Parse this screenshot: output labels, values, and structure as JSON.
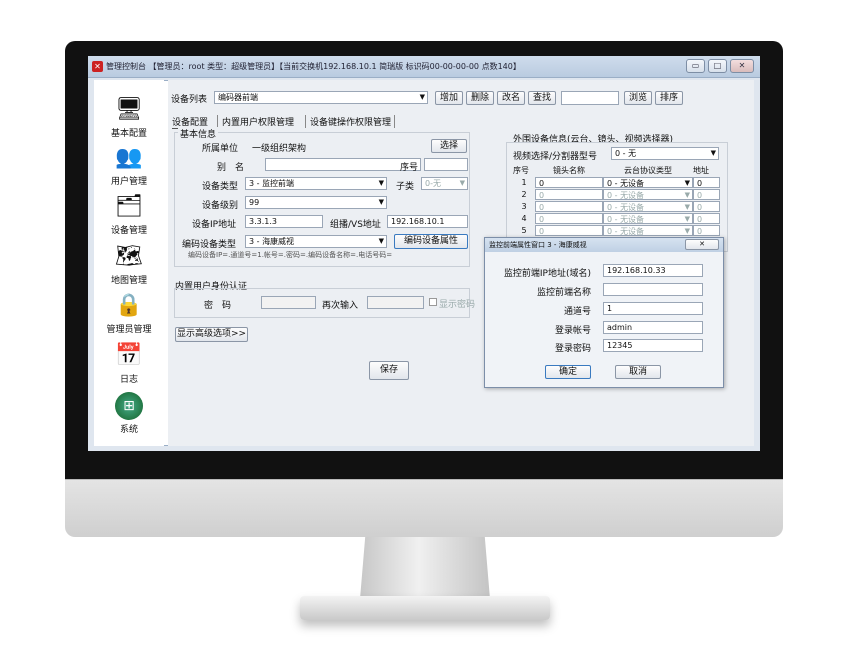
{
  "window": {
    "title": "管理控制台 【管理员：root 类型：超级管理员】【当前交换机192.168.10.1 简瑞版 标识码00-00-00-00 点数140】",
    "buttons": {
      "minimize": "▭",
      "maximize": "□",
      "close": "✕"
    }
  },
  "sidebar": {
    "items": [
      {
        "label": "基本配置",
        "icon": "computer-icon"
      },
      {
        "label": "用户管理",
        "icon": "users-icon"
      },
      {
        "label": "设备管理",
        "icon": "devices-icon"
      },
      {
        "label": "地图管理",
        "icon": "map-icon"
      },
      {
        "label": "管理员管理",
        "icon": "admin-lock-icon"
      },
      {
        "label": "日志",
        "icon": "calendar-clock-icon"
      },
      {
        "label": "系统",
        "icon": "windows-logo-icon"
      }
    ]
  },
  "toolbar": {
    "device_list_label": "设备列表",
    "device_list_value": "编码器前端",
    "add": "增加",
    "delete": "删除",
    "rename": "改名",
    "search": "查找",
    "search_value": "",
    "browse": "浏览",
    "sort": "排序"
  },
  "tabs": [
    "设备配置",
    "内置用户权限管理",
    "设备键操作权限管理"
  ],
  "basic": {
    "group_title": "基本信息",
    "unit_label": "所属单位",
    "unit_value": "一级组织架构",
    "select_btn": "选择",
    "alias_label": "别　名",
    "alias_value": "",
    "seq_label": "序号",
    "seq_value": "",
    "type_label": "设备类型",
    "type_value": "3 - 监控前端",
    "subtype_label": "子类",
    "subtype_value": "0-无",
    "level_label": "设备级别",
    "level_value": "99",
    "ip_label": "设备IP地址",
    "ip_value": "3.3.1.3",
    "mcast_label": "组播/VS地址",
    "mcast_value": "192.168.10.1",
    "enc_label": "编码设备类型",
    "enc_value": "3 - 海康威视",
    "enc_btn": "编码设备属性",
    "enc_hint": "编码设备IP=.通道号=1.帐号=.密码=.编码设备名称=.电话号码="
  },
  "auth": {
    "title": "内置用户身份认证",
    "pwd_label": "密　码",
    "pwd_value": "",
    "pwd2_label": "再次输入",
    "pwd2_value": "",
    "show_pwd": "显示密码"
  },
  "advanced_btn": "显示高级选项>>",
  "save_btn": "保存",
  "peripheral": {
    "title": "外围设备信息(云台、镜头、视频选择器)",
    "selector_label": "视频选择/分割器型号",
    "selector_value": "0 - 无",
    "headers": [
      "序号",
      "镜头名称",
      "云台协议类型",
      "地址"
    ],
    "rows": [
      {
        "no": "1",
        "name": "0",
        "ptz": "0 - 无设备",
        "addr": "0"
      },
      {
        "no": "2",
        "name": "0",
        "ptz": "0 - 无设备",
        "addr": "0"
      },
      {
        "no": "3",
        "name": "0",
        "ptz": "0 - 无设备",
        "addr": "0"
      },
      {
        "no": "4",
        "name": "0",
        "ptz": "0 - 无设备",
        "addr": "0"
      },
      {
        "no": "5",
        "name": "0",
        "ptz": "0 - 无设备",
        "addr": "0"
      }
    ]
  },
  "dialog": {
    "title": "监控前端属性窗口 3 - 海康威视",
    "close": "✕",
    "fields": [
      {
        "label": "监控前端IP地址(域名)",
        "value": "192.168.10.33"
      },
      {
        "label": "监控前端名称",
        "value": ""
      },
      {
        "label": "通道号",
        "value": "1"
      },
      {
        "label": "登录帐号",
        "value": "admin"
      },
      {
        "label": "登录密码",
        "value": "12345"
      }
    ],
    "ok": "确定",
    "cancel": "取消"
  }
}
